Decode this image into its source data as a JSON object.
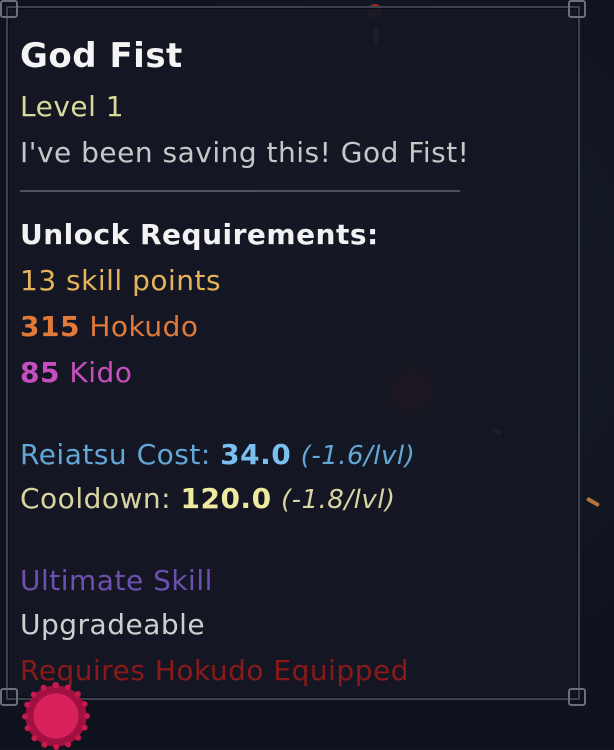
{
  "tooltip": {
    "title": "God Fist",
    "level": "Level 1",
    "description": "I've been saving this! God Fist!",
    "unlock_header": "Unlock Requirements:",
    "skill_points": "13 skill points",
    "hokudo_value": "315",
    "hokudo_label": "Hokudo",
    "kido_value": "85",
    "kido_label": "Kido",
    "reiatsu_label": "Reiatsu Cost:",
    "reiatsu_value": "34.0",
    "reiatsu_per_level": "(-1.6/lvl)",
    "cooldown_label": "Cooldown:",
    "cooldown_value": "120.0",
    "cooldown_per_level": "(-1.8/lvl)",
    "ultimate": "Ultimate Skill",
    "upgradeable": "Upgradeable",
    "requires": "Requires Hokudo Equipped"
  },
  "colors": {
    "title": "#f4f4f4",
    "level": "#d8d89a",
    "skill_points": "#e6b35a",
    "hokudo": "#e07a3a",
    "kido": "#c64fbf",
    "reiatsu": "#63a7d6",
    "cooldown": "#d8d5a1",
    "ultimate": "#6d4fb0",
    "requires": "#8a1a1a"
  },
  "icons": [
    "orb-icon",
    "gear-icon"
  ]
}
